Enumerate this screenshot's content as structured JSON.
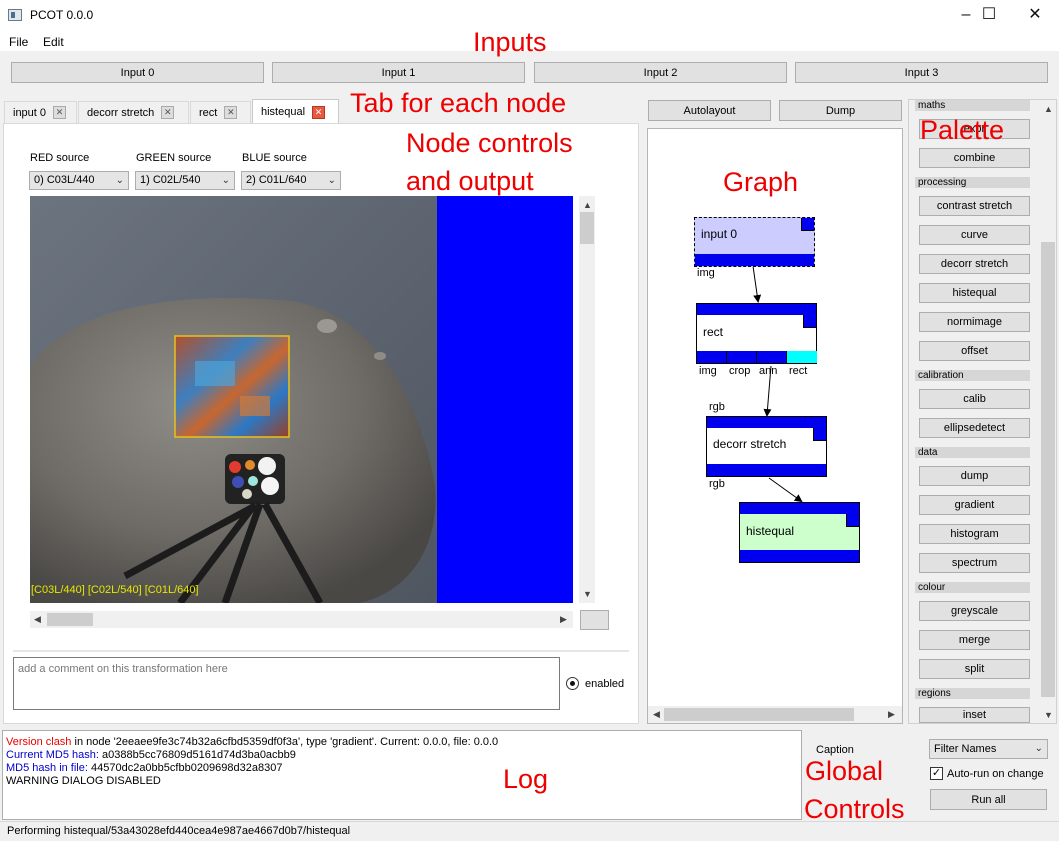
{
  "window": {
    "title": "PCOT 0.0.0"
  },
  "menu": [
    "File",
    "Edit"
  ],
  "inputs": [
    "Input 0",
    "Input 1",
    "Input 2",
    "Input 3"
  ],
  "tabs": [
    {
      "label": "input 0"
    },
    {
      "label": "decorr stretch"
    },
    {
      "label": "rect"
    },
    {
      "label": "histequal"
    }
  ],
  "sources": {
    "red_label": "RED source",
    "green_label": "GREEN source",
    "blue_label": "BLUE source",
    "red_value": "0) C03L/440",
    "green_value": "1) C02L/540",
    "blue_value": "2) C01L/640"
  },
  "image": {
    "caption": "[C03L/440] [C02L/540] [C01L/640]"
  },
  "comment": {
    "placeholder": "add a comment on this transformation here"
  },
  "enabled_label": "enabled",
  "graph_buttons": {
    "autolayout": "Autolayout",
    "dump": "Dump"
  },
  "graph": {
    "nodes": {
      "input0": {
        "label": "input 0",
        "out": "img"
      },
      "rect": {
        "label": "rect",
        "outs": [
          "img",
          "crop",
          "ann",
          "rect"
        ],
        "in": "rgb"
      },
      "decorr": {
        "label": "decorr stretch",
        "in": "rgb",
        "out": "rgb"
      },
      "histequal": {
        "label": "histequal"
      }
    }
  },
  "palette": {
    "sections": [
      {
        "name": "maths",
        "items": [
          "expr",
          "combine"
        ]
      },
      {
        "name": "processing",
        "items": [
          "contrast stretch",
          "curve",
          "decorr stretch",
          "histequal",
          "normimage",
          "offset"
        ]
      },
      {
        "name": "calibration",
        "items": [
          "calib",
          "ellipsedetect"
        ]
      },
      {
        "name": "data",
        "items": [
          "dump",
          "gradient",
          "histogram",
          "spectrum"
        ]
      },
      {
        "name": "colour",
        "items": [
          "greyscale",
          "merge",
          "split"
        ]
      },
      {
        "name": "regions",
        "items": [
          "inset"
        ]
      }
    ]
  },
  "log": {
    "line1_red": "Version clash",
    "line1_rest": " in node '2eeaee9fe3c74b32a6cfbd5359df0f3a', type 'gradient'. Current: 0.0.0, file: 0.0.0",
    "line2_label": "Current MD5 hash:",
    "line2_value": " a0388b5cc76809d5161d74d3ba0acbb9",
    "line3_label": "MD5 hash in file:",
    "line3_value": " 44570dc2a0bb5cfbb0209698d32a8307",
    "line4": "WARNING DIALOG DISABLED"
  },
  "global": {
    "caption_label": "Caption",
    "filter_value": "Filter Names",
    "autorun_label": "Auto-run on change",
    "run_all": "Run all"
  },
  "status": "Performing histequal/53a43028efd440cea4e987ae4667d0b7/histequal",
  "annotations": {
    "inputs": "Inputs",
    "tab": "Tab for each node",
    "node_controls": "Node controls",
    "and_output": "and output",
    "graph": "Graph",
    "palette": "Palette",
    "log": "Log",
    "global1": "Global",
    "global2": "Controls"
  },
  "colors": {
    "node_blue": "#0000ee",
    "annotation_red": "#e00000",
    "input_node_fill": "#ccccff",
    "histequal_fill": "#ccffcc",
    "rect_port": "#00ffff"
  }
}
